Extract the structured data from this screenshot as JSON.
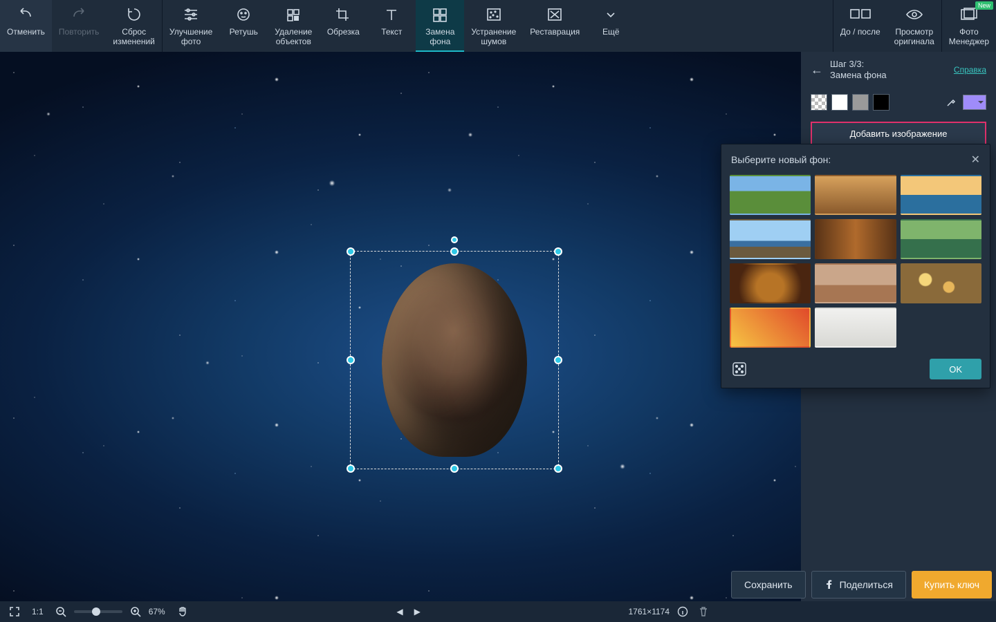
{
  "toolbar": {
    "undo": "Отменить",
    "redo": "Повторить",
    "reset": "Сброс\nизменений",
    "enhance": "Улучшение\nфото",
    "retouch": "Ретушь",
    "removeobj": "Удаление\nобъектов",
    "crop": "Обрезка",
    "text": "Текст",
    "bgreplace": "Замена\nфона",
    "denoise": "Устранение\nшумов",
    "restore": "Реставрация",
    "more": "Ещё",
    "beforeafter": "До / после",
    "vieworiginal": "Просмотр\nоригинала",
    "photomanager": "Фото\nМенеджер",
    "new_badge": "New"
  },
  "sidebar": {
    "step": "Шаг 3/3:",
    "title": "Замена фона",
    "help": "Справка",
    "add_image": "Добавить изображение"
  },
  "popup": {
    "title": "Выберите новый фон:",
    "ok": "OK"
  },
  "bottombar": {
    "fit_label": "1:1",
    "zoom_pct": "67%",
    "dimensions": "1761×1174"
  },
  "actions": {
    "save": "Сохранить",
    "share": "Поделиться",
    "buy": "Купить ключ"
  }
}
